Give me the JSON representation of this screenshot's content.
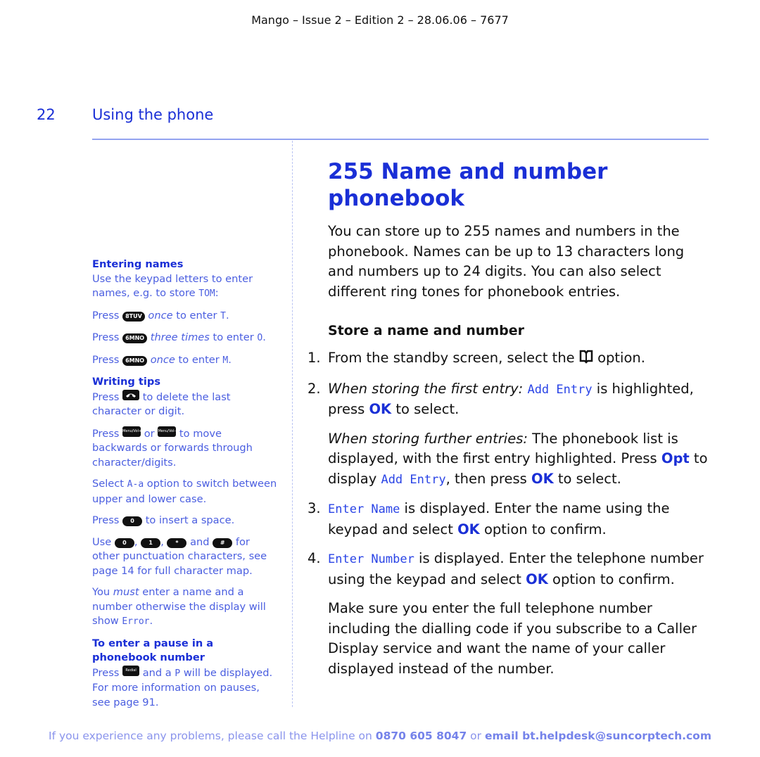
{
  "header": {
    "doc_info": "Mango – Issue 2 – Edition 2 – 28.06.06 – 7677"
  },
  "page": {
    "number": "22",
    "section_title": "Using the phone"
  },
  "sidebar": {
    "entering_names": {
      "heading": "Entering names",
      "intro_a": "Use the keypad letters to enter names, e.g. to store ",
      "intro_example": "TOM",
      "intro_b": ":",
      "steps": [
        {
          "press": "Press",
          "key": "8TUV",
          "qualifier": "once",
          "rest": " to enter ",
          "char": "T",
          "end": "."
        },
        {
          "press": "Press",
          "key": "6MNO",
          "qualifier": "three times",
          "rest": " to enter ",
          "char": "O",
          "end": "."
        },
        {
          "press": "Press",
          "key": "6MNO",
          "qualifier": "once",
          "rest": " to enter ",
          "char": "M",
          "end": "."
        }
      ]
    },
    "writing_tips": {
      "heading": "Writing tips",
      "delete_a": "Press",
      "delete_key": "end-call-icon",
      "delete_b": " to delete the last character or digit.",
      "move_a": "Press",
      "move_key_1": "Menu/Vol+",
      "move_or": " or ",
      "move_key_2": "Menu/Vol–",
      "move_b": " to move backwards or forwards through character/digits.",
      "case_a": "Select ",
      "case_option": "A-a",
      "case_b": " option to switch between upper and lower case.",
      "space_a": "Press",
      "space_key": "0",
      "space_b": " to insert a space.",
      "punct_a": "Use",
      "punct_keys": [
        "0",
        "1",
        "*",
        "#"
      ],
      "punct_and": " and ",
      "punct_b": " for other punctuation characters, see page 14 for full character map.",
      "must_a": "You ",
      "must_em": "must",
      "must_b": " enter a name and a number otherwise the display will show ",
      "must_error": "Error",
      "must_end": "."
    },
    "pause": {
      "heading": "To enter a pause in a phonebook number",
      "a": "Press",
      "key": "Redial",
      "b": " and a ",
      "char": "P",
      "c": " will be displayed. For more information on pauses, see page 91."
    }
  },
  "main": {
    "title": "255 Name and number phonebook",
    "intro": "You can store up to 255 names and numbers in the phonebook. Names can be up to 13 characters long and numbers up to 24 digits. You can also select different ring tones for phonebook entries.",
    "subheading": "Store a name and number",
    "steps": [
      {
        "n": "1.",
        "a": "From the standby screen, select the ",
        "icon": "phonebook-icon",
        "b": " option."
      },
      {
        "n": "2.",
        "em": "When storing the first entry:",
        "lcd": "Add Entry",
        "a": " is highlighted, press ",
        "ok": "OK",
        "b": " to select."
      },
      {
        "n": "3.",
        "lcd": "Enter Name",
        "a": " is displayed. Enter the name using the keypad and select ",
        "ok": "OK",
        "b": " option to confirm."
      },
      {
        "n": "4.",
        "lcd": "Enter Number",
        "a": " is displayed. Enter the telephone number using the keypad and select ",
        "ok": "OK",
        "b": " option to confirm."
      }
    ],
    "further": {
      "em": "When storing further entries:",
      "a": " The phonebook list is displayed, with the first entry highlighted. Press ",
      "opt": "Opt",
      "b": " to display ",
      "lcd": "Add Entry",
      "c": ", then press ",
      "ok": "OK",
      "d": " to select."
    },
    "note": "Make sure you enter the full telephone number including the dialling code if you subscribe to a Caller Display service and want the name of your caller displayed instead of the number."
  },
  "footer": {
    "a": "If you experience any problems, please call the Helpline on ",
    "phone": "0870 605 8047",
    "b": " or ",
    "email": "email bt.helpdesk@suncorptech.com"
  },
  "colors": {
    "accent": "#1a2fd6",
    "sidebar_text": "#4a5ee0",
    "rule": "#93a3f0"
  }
}
